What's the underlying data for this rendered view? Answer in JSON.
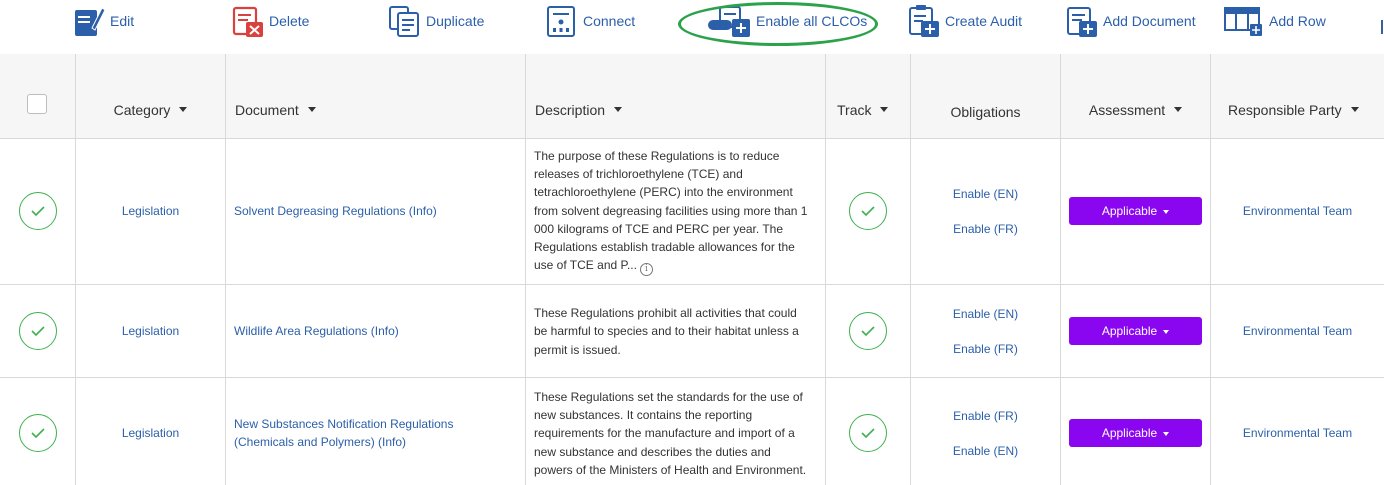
{
  "toolbar": {
    "edit": "Edit",
    "delete": "Delete",
    "duplicate": "Duplicate",
    "connect": "Connect",
    "enable_all": "Enable all CLCOs",
    "create_audit": "Create Audit",
    "add_document": "Add Document",
    "add_row": "Add Row"
  },
  "columns": {
    "category": "Category",
    "document": "Document",
    "description": "Description",
    "track": "Track",
    "obligations": "Obligations",
    "assessment": "Assessment",
    "responsible_party": "Responsible Party"
  },
  "rows": [
    {
      "category": "Legislation",
      "document": "Solvent Degreasing Regulations (Info)",
      "description_lines": [
        "The purpose of these Regulations is to reduce",
        "releases of trichloroethylene (TCE) and",
        "tetrachloroethylene (PERC) into the environment",
        "from solvent degreasing facilities using more than 1",
        "000 kilograms of TCE and PERC per year. The",
        "Regulations establish tradable allowances for the",
        "use of TCE and P..."
      ],
      "obligations": [
        "Enable (EN)",
        "Enable (FR)"
      ],
      "assessment": "Applicable",
      "responsible_party": "Environmental Team"
    },
    {
      "category": "Legislation",
      "document": "Wildlife Area Regulations (Info)",
      "description_lines": [
        "These Regulations prohibit all activities that could",
        "be harmful to species and to their habitat unless a",
        "permit is issued."
      ],
      "obligations": [
        "Enable (EN)",
        "Enable (FR)"
      ],
      "assessment": "Applicable",
      "responsible_party": "Environmental Team"
    },
    {
      "category": "Legislation",
      "document_lines": [
        "New Substances Notification Regulations",
        "(Chemicals and Polymers) (Info)"
      ],
      "description_lines": [
        "These Regulations set the standards for the use of",
        "new substances. It contains the reporting",
        "requirements for the manufacture and import of a",
        "new substance and describes the duties and",
        "powers of the Ministers of Health and Environment."
      ],
      "obligations": [
        "Enable (FR)",
        "Enable (EN)"
      ],
      "assessment": "Applicable",
      "responsible_party": "Environmental Team"
    }
  ],
  "colors": {
    "link": "#2b5faa",
    "assessment_button": "#8a05f0",
    "check_green": "#3fb24f",
    "highlight_green": "#2ca24b",
    "header_bg": "#f6f6f6",
    "border": "#d9d9d9"
  },
  "icons": {
    "edit": "edit-document-icon",
    "delete": "delete-document-icon",
    "duplicate": "duplicate-document-icon",
    "connect": "connect-document-icon",
    "enable_all": "enable-clco-icon",
    "create_audit": "create-audit-icon",
    "add_document": "add-document-icon",
    "add_row": "add-row-icon",
    "track": "check-circle-icon",
    "info": "info-icon"
  }
}
